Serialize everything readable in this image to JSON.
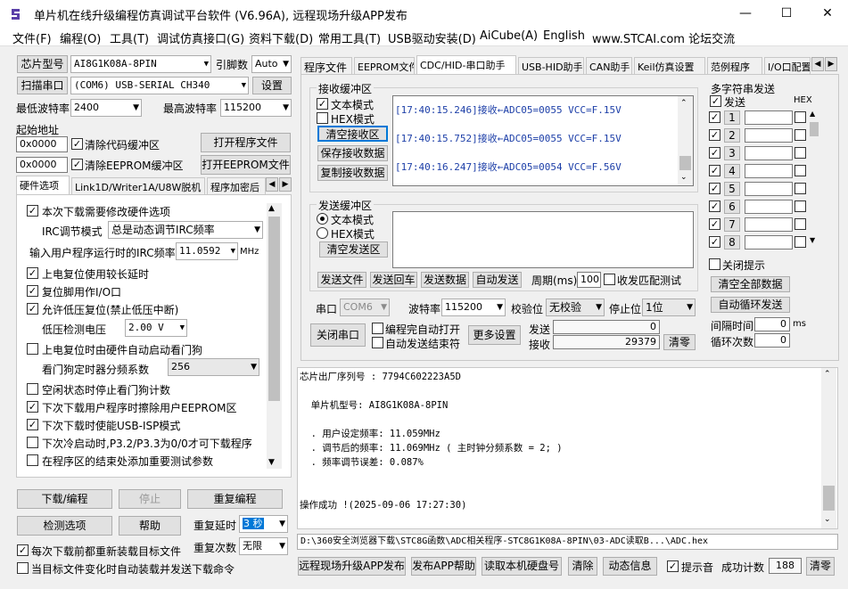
{
  "window": {
    "title": "单片机在线升级编程仿真调试平台软件 (V6.96A), 远程现场升级APP发布",
    "min": "—",
    "max": "☐",
    "close": "✕"
  },
  "menu": [
    "文件(F)",
    "编程(O)",
    "工具(T)",
    "调试仿真接口(G)",
    "资料下载(D)",
    "常用工具(T)",
    "USB驱动安装(D)",
    "AiCube(A)",
    "English",
    "www.STCAI.com 论坛交流"
  ],
  "left": {
    "chip_btn": "芯片型号",
    "chip_value": "AI8G1K08A-8PIN",
    "pins_label": "引脚数",
    "pins_value": "Auto",
    "scan_btn": "扫描串口",
    "port_value": "(COM6) USB-SERIAL CH340",
    "settings_btn": "设置",
    "min_baud_label": "最低波特率",
    "min_baud": "2400",
    "max_baud_label": "最高波特率",
    "max_baud": "115200",
    "start_addr_label": "起始地址",
    "addr1": "0x0000",
    "clear_code": "清除代码缓冲区",
    "open_prog": "打开程序文件",
    "addr2": "0x0000",
    "clear_eeprom": "清除EEPROM缓冲区",
    "open_eeprom": "打开EEPROM文件",
    "tabs": [
      "硬件选项",
      "Link1D/Writer1A/U8W脱机",
      "程序加密后"
    ],
    "opts": {
      "o1": "本次下载需要修改硬件选项",
      "irc_mode_label": "IRC调节模式",
      "irc_mode": "总是动态调节IRC频率",
      "irc_freq_label": "输入用户程序运行时的IRC频率",
      "irc_freq": "11.0592",
      "mhz": "MHz",
      "o2": "上电复位使用较长延时",
      "o3": "复位脚用作I/O口",
      "o4": "允许低压复位(禁止低压中断)",
      "lv_label": "低压检测电压",
      "lv_value": "2.00 V",
      "o5": "上电复位时由硬件自动启动看门狗",
      "wdt_label": "看门狗定时器分频系数",
      "wdt_value": "256",
      "o6": "空闲状态时停止看门狗计数",
      "o7": "下次下载用户程序时擦除用户EEPROM区",
      "o8": "下次下载时使能USB-ISP模式",
      "o9": "下次冷启动时,P3.2/P3.3为0/0才可下载程序",
      "o10": "在程序区的结束处添加重要测试参数"
    },
    "download_btn": "下载/编程",
    "stop_btn": "停止",
    "reprog_btn": "重复编程",
    "detect_btn": "检测选项",
    "help_btn": "帮助",
    "delay_label": "重复延时",
    "delay_value": "3 秒",
    "reload_label": "每次下载前都重新装载目标文件",
    "count_label": "重复次数",
    "count_value": "无限",
    "auto_label": "当目标文件变化时自动装载并发送下载命令"
  },
  "right": {
    "tabs": [
      "程序文件",
      "EEPROM文件",
      "CDC/HID-串口助手",
      "USB-HID助手",
      "CAN助手",
      "Keil仿真设置",
      "范例程序",
      "I/O口配置"
    ],
    "rx_title": "接收缓冲区",
    "text_mode": "文本模式",
    "hex_mode": "HEX模式",
    "clear_rx": "清空接收区",
    "save_rx": "保存接收数据",
    "copy_rx": "复制接收数据",
    "rx_lines": [
      "[17:40:15.246]接收←ADC05=0055  VCC=F.15V",
      "[17:40:15.752]接收←ADC05=0055  VCC=F.15V",
      "[17:40:16.247]接收←ADC05=0054  VCC=F.56V"
    ],
    "tx_title": "发送缓冲区",
    "tx_text_mode": "文本模式",
    "tx_hex_mode": "HEX模式",
    "clear_tx": "清空发送区",
    "send_file": "发送文件",
    "send_enter": "发送回车",
    "send_data": "发送数据",
    "auto_send": "自动发送",
    "period_label": "周期(ms)",
    "period": "100",
    "match_test": "收发匹配测试",
    "port_label": "串口",
    "port": "COM6",
    "baud_label": "波特率",
    "baud": "115200",
    "parity_label": "校验位",
    "parity": "无校验",
    "stop_label": "停止位",
    "stop": "1位",
    "close_port": "关闭串口",
    "auto_open": "编程完自动打开",
    "auto_stop": "自动发送结束符",
    "more": "更多设置",
    "send_label": "发送",
    "send_count": "0",
    "recv_label": "接收",
    "recv_count": "29379",
    "clear_count": "清零",
    "multi_title": "多字符串发送",
    "send_col": "发送",
    "hex_col": "HEX",
    "rows": [
      "1",
      "2",
      "3",
      "4",
      "5",
      "6",
      "7",
      "8"
    ],
    "close_tip": "关闭提示",
    "clear_all": "清空全部数据",
    "auto_loop": "自动循环发送",
    "interval_label": "间隔时间",
    "interval": "0",
    "ms": "ms",
    "loop_label": "循环次数",
    "loop_count": "0"
  },
  "output": {
    "lines": [
      "芯片出厂序列号 : 7794C602223A5D",
      "",
      "  单片机型号: AI8G1K08A-8PIN",
      "",
      "  . 用户设定频率: 11.059MHz",
      "  . 调节后的频率: 11.069MHz ( 主时钟分频系数 = 2; )",
      "  . 频率调节误差: 0.087%",
      "",
      "",
      "操作成功 !(2025-09-06 17:27:30)"
    ]
  },
  "filepath": "D:\\360安全浏览器下载\\STC8G函数\\ADC相关程序-STC8G1K08A-8PIN\\03-ADC读取B...\\ADC.hex",
  "bottom": {
    "remote_btn": "远程现场升级APP发布",
    "publish_help": "发布APP帮助",
    "read_disk": "读取本机硬盘号",
    "clear": "清除",
    "anim": "动态信息",
    "beep": "提示音",
    "success_label": "成功计数",
    "success": "188",
    "reset": "清零"
  },
  "colors": {
    "titlebar": "#ffffff",
    "face": "#f0f0f0",
    "log_text": "#1d3fa8",
    "accent": "#0078d7"
  }
}
